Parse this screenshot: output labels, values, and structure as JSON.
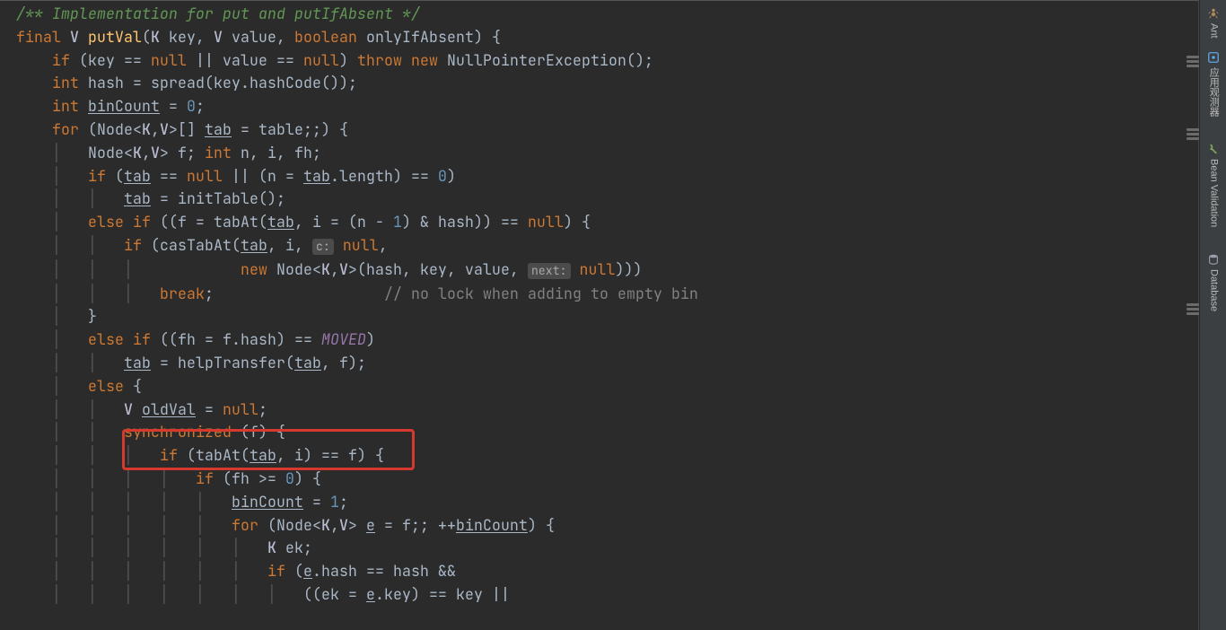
{
  "toolbar_right": {
    "items": [
      {
        "id": "ant",
        "label": "Ant"
      },
      {
        "id": "observer",
        "label": "应用观测器"
      },
      {
        "id": "bean",
        "label": "Bean Validation"
      },
      {
        "id": "db",
        "label": "Database"
      }
    ]
  },
  "highlight_region": {
    "line": "synchronized (f) {"
  },
  "code": {
    "tokens": [
      [
        "doc",
        "/** Implementation for put and putIfAbsent */"
      ],
      [
        "nl"
      ],
      [
        "kw",
        "final"
      ],
      [
        "p",
        " "
      ],
      [
        "type",
        "V"
      ],
      [
        "p",
        " "
      ],
      [
        "m",
        "putVal"
      ],
      [
        "p",
        "("
      ],
      [
        "type",
        "K"
      ],
      [
        "p",
        " key, "
      ],
      [
        "type",
        "V"
      ],
      [
        "p",
        " value, "
      ],
      [
        "kw",
        "boolean"
      ],
      [
        "p",
        " onlyIfAbsent) {"
      ],
      [
        "nl"
      ],
      [
        "p",
        "    "
      ],
      [
        "kw",
        "if"
      ],
      [
        "p",
        " (key == "
      ],
      [
        "kw",
        "null"
      ],
      [
        "p",
        " || value == "
      ],
      [
        "kw",
        "null"
      ],
      [
        "p",
        ") "
      ],
      [
        "kw",
        "throw new"
      ],
      [
        "p",
        " NullPointerException();"
      ],
      [
        "nl"
      ],
      [
        "p",
        "    "
      ],
      [
        "kw",
        "int"
      ],
      [
        "p",
        " hash = spread(key.hashCode());"
      ],
      [
        "nl"
      ],
      [
        "p",
        "    "
      ],
      [
        "kw",
        "int"
      ],
      [
        "p",
        " "
      ],
      [
        "u",
        "binCount"
      ],
      [
        "p",
        " = "
      ],
      [
        "num",
        "0"
      ],
      [
        "p",
        ";"
      ],
      [
        "nl"
      ],
      [
        "p",
        "    "
      ],
      [
        "kw",
        "for"
      ],
      [
        "p",
        " (Node<"
      ],
      [
        "type",
        "K"
      ],
      [
        "p",
        ","
      ],
      [
        "type",
        "V"
      ],
      [
        "p",
        ">[] "
      ],
      [
        "u",
        "tab"
      ],
      [
        "p",
        " = "
      ],
      [
        "id",
        "table"
      ],
      [
        "p",
        ";;) {"
      ],
      [
        "nl"
      ],
      [
        "p",
        "    "
      ],
      [
        "guide",
        "│   "
      ],
      [
        "p",
        "Node<"
      ],
      [
        "type",
        "K"
      ],
      [
        "p",
        ","
      ],
      [
        "type",
        "V"
      ],
      [
        "p",
        "> f; "
      ],
      [
        "kw",
        "int"
      ],
      [
        "p",
        " "
      ],
      [
        "id",
        "n"
      ],
      [
        "p",
        ", "
      ],
      [
        "id",
        "i"
      ],
      [
        "p",
        ", "
      ],
      [
        "id",
        "fh"
      ],
      [
        "p",
        ";"
      ],
      [
        "nl"
      ],
      [
        "p",
        "    "
      ],
      [
        "guide",
        "│   "
      ],
      [
        "kw",
        "if"
      ],
      [
        "p",
        " ("
      ],
      [
        "u",
        "tab"
      ],
      [
        "p",
        " == "
      ],
      [
        "kw",
        "null"
      ],
      [
        "p",
        " || (n = "
      ],
      [
        "u",
        "tab"
      ],
      [
        "p",
        ".length) == "
      ],
      [
        "num",
        "0"
      ],
      [
        "p",
        ")"
      ],
      [
        "nl"
      ],
      [
        "p",
        "    "
      ],
      [
        "guide",
        "│   │   "
      ],
      [
        "u",
        "tab"
      ],
      [
        "p",
        " = initTable();"
      ],
      [
        "nl"
      ],
      [
        "p",
        "    "
      ],
      [
        "guide",
        "│   "
      ],
      [
        "kw",
        "else if"
      ],
      [
        "p",
        " ((f = tabAt("
      ],
      [
        "u",
        "tab"
      ],
      [
        "p",
        ", i = (n - "
      ],
      [
        "num",
        "1"
      ],
      [
        "p",
        ") & hash)) == "
      ],
      [
        "kw",
        "null"
      ],
      [
        "p",
        ") {"
      ],
      [
        "nl"
      ],
      [
        "p",
        "    "
      ],
      [
        "guide",
        "│   │   "
      ],
      [
        "kw",
        "if"
      ],
      [
        "p",
        " (casTabAt("
      ],
      [
        "u",
        "tab"
      ],
      [
        "p",
        ", i, "
      ],
      [
        "hint",
        "c:"
      ],
      [
        "p",
        " "
      ],
      [
        "kw",
        "null"
      ],
      [
        "p",
        ","
      ],
      [
        "nl"
      ],
      [
        "p",
        "    "
      ],
      [
        "guide",
        "│   │   │            "
      ],
      [
        "kw",
        "new"
      ],
      [
        "p",
        " Node<"
      ],
      [
        "type",
        "K"
      ],
      [
        "p",
        ","
      ],
      [
        "type",
        "V"
      ],
      [
        "p",
        ">(hash, key, value, "
      ],
      [
        "hint",
        "next:"
      ],
      [
        "p",
        " "
      ],
      [
        "kw",
        "null"
      ],
      [
        "p",
        ")))"
      ],
      [
        "nl"
      ],
      [
        "p",
        "    "
      ],
      [
        "guide",
        "│   │   │   "
      ],
      [
        "kw",
        "break"
      ],
      [
        "p",
        ";                   "
      ],
      [
        "cmt",
        "// no lock when adding to empty bin"
      ],
      [
        "nl"
      ],
      [
        "p",
        "    "
      ],
      [
        "guide",
        "│   "
      ],
      [
        "p",
        "}"
      ],
      [
        "nl"
      ],
      [
        "p",
        "    "
      ],
      [
        "guide",
        "│   "
      ],
      [
        "kw",
        "else if"
      ],
      [
        "p",
        " ((fh = f.hash) == "
      ],
      [
        "const",
        "MOVED"
      ],
      [
        "p",
        ")"
      ],
      [
        "nl"
      ],
      [
        "p",
        "    "
      ],
      [
        "guide",
        "│   │   "
      ],
      [
        "u",
        "tab"
      ],
      [
        "p",
        " = helpTransfer("
      ],
      [
        "u",
        "tab"
      ],
      [
        "p",
        ", f);"
      ],
      [
        "nl"
      ],
      [
        "p",
        "    "
      ],
      [
        "guide",
        "│   "
      ],
      [
        "kw",
        "else"
      ],
      [
        "p",
        " {"
      ],
      [
        "nl"
      ],
      [
        "p",
        "    "
      ],
      [
        "guide",
        "│   │   "
      ],
      [
        "type",
        "V"
      ],
      [
        "p",
        " "
      ],
      [
        "u",
        "oldVal"
      ],
      [
        "p",
        " = "
      ],
      [
        "kw",
        "null"
      ],
      [
        "p",
        ";"
      ],
      [
        "nl"
      ],
      [
        "p",
        "    "
      ],
      [
        "guide",
        "│   │   "
      ],
      [
        "kw",
        "synchronized"
      ],
      [
        "p",
        " (f) {"
      ],
      [
        "nl"
      ],
      [
        "p",
        "    "
      ],
      [
        "guide",
        "│   │   │   "
      ],
      [
        "kw",
        "if"
      ],
      [
        "p",
        " (tabAt("
      ],
      [
        "u",
        "tab"
      ],
      [
        "p",
        ", i) == f) {"
      ],
      [
        "nl"
      ],
      [
        "p",
        "    "
      ],
      [
        "guide",
        "│   │   │   │   "
      ],
      [
        "kw",
        "if"
      ],
      [
        "p",
        " (fh >= "
      ],
      [
        "num",
        "0"
      ],
      [
        "p",
        ") {"
      ],
      [
        "nl"
      ],
      [
        "p",
        "    "
      ],
      [
        "guide",
        "│   │   │   │   │   "
      ],
      [
        "u",
        "binCount"
      ],
      [
        "p",
        " = "
      ],
      [
        "num",
        "1"
      ],
      [
        "p",
        ";"
      ],
      [
        "nl"
      ],
      [
        "p",
        "    "
      ],
      [
        "guide",
        "│   │   │   │   │   "
      ],
      [
        "kw",
        "for"
      ],
      [
        "p",
        " (Node<"
      ],
      [
        "type",
        "K"
      ],
      [
        "p",
        ","
      ],
      [
        "type",
        "V"
      ],
      [
        "p",
        "> "
      ],
      [
        "u",
        "e"
      ],
      [
        "p",
        " = f;; ++"
      ],
      [
        "u",
        "binCount"
      ],
      [
        "p",
        ") {"
      ],
      [
        "nl"
      ],
      [
        "p",
        "    "
      ],
      [
        "guide",
        "│   │   │   │   │   │   "
      ],
      [
        "type",
        "K"
      ],
      [
        "p",
        " ek;"
      ],
      [
        "nl"
      ],
      [
        "p",
        "    "
      ],
      [
        "guide",
        "│   │   │   │   │   │   "
      ],
      [
        "kw",
        "if"
      ],
      [
        "p",
        " ("
      ],
      [
        "u",
        "e"
      ],
      [
        "p",
        ".hash == hash &&"
      ],
      [
        "nl"
      ],
      [
        "p",
        "    "
      ],
      [
        "guide",
        "│   │   │   │   │   │   │   "
      ],
      [
        "p",
        "((ek = "
      ],
      [
        "u",
        "e"
      ],
      [
        "p",
        ".key) == key ||"
      ],
      [
        "nl"
      ]
    ]
  }
}
